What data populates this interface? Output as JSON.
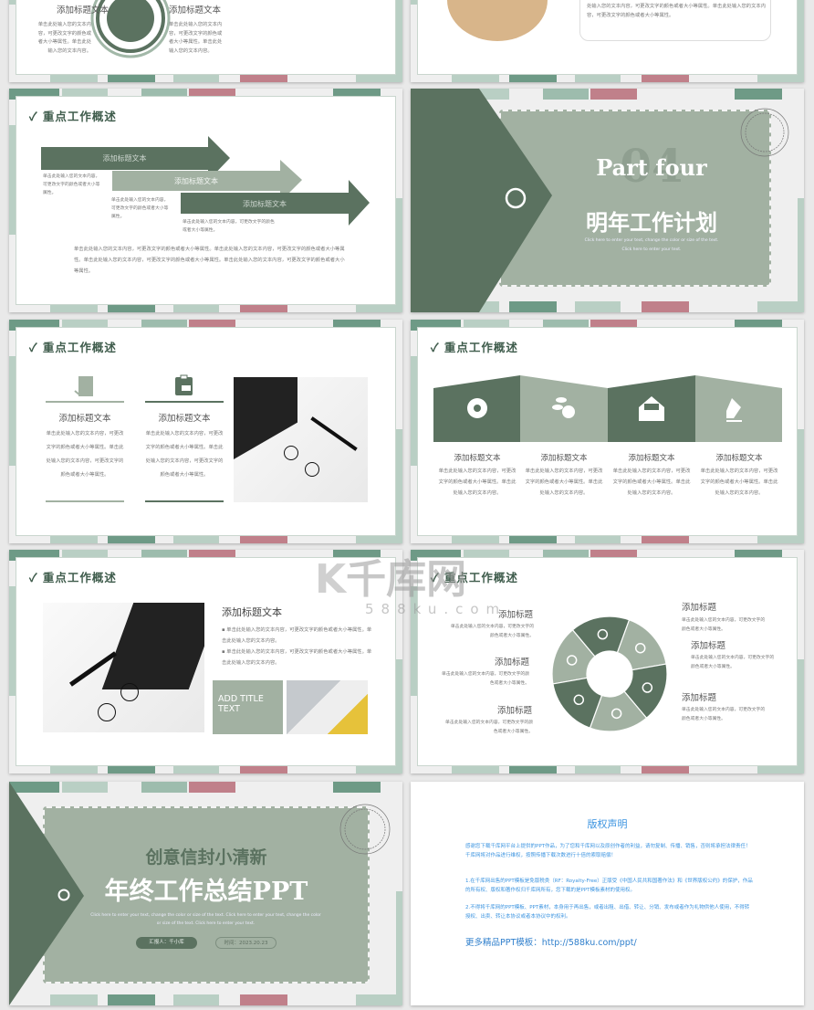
{
  "palette": {
    "dark_green": "#5b7260",
    "sage": "#a2b1a2",
    "teal": "#6e9a86",
    "mint": "#b9cfc4",
    "pink": "#c0808a",
    "copyright_blue": "#3c94e0"
  },
  "watermark": {
    "brand": "千库网",
    "domain": "588ku.com"
  },
  "section_title": "重点工作概述",
  "check_icon": "✓",
  "heading": "添加标题文本",
  "heading_short": "添加标题",
  "body_short": "单击此处输入您的文本内容，可更改文字的颜色或者大小等属性。",
  "body_long": "单击此处输入您的文本内容，可更改文字的颜色或者大小等属性。单击此处输入您的文本内容。",
  "body_col": "单击此处输入您的文本内容，可更改文字的颜色或者大小等属性。单击此处输入您的文本内容，可更改文字的颜色或者大小等属性。",
  "top_partial": {
    "left_text": "单击此处输入您的文本内容，可更改文字的颜色或者大小等属性。单击此处输入您的文本内容。",
    "right_text": "处输入您的文本内容，可更改文字的颜色或者大小等属性。单击此处输入您的文本内容，可更改文字的颜色或者大小等属性。"
  },
  "slide_arrows": {
    "paragraph": "单击此处输入您的文本内容，可更改文字的颜色或者大小等属性。单击此处输入您的文本内容，可更改文字的颜色或者大小等属性。单击此处输入您的文本内容，可更改文字的颜色或者大小等属性。单击此处输入您的文本内容，可更改文字的颜色或者大小等属性。"
  },
  "slide_part": {
    "number": "04",
    "part": "Part four",
    "title": "明年工作计划",
    "sub1": "Click here to enter your text, change the color or size of the text.",
    "sub2": "Click here to enter your text."
  },
  "slide_icons": {
    "icons": [
      "settings-icon",
      "coins-check-icon",
      "mail-open-icon",
      "pen-nib-icon"
    ]
  },
  "slide_photo": {
    "box_label": "ADD TITLE TEXT"
  },
  "slide_ring": {
    "icons": [
      "leaf-icon",
      "apple-icon",
      "image-icon",
      "document-icon",
      "microscope-icon",
      "target-icon"
    ]
  },
  "cover": {
    "subtitle": "创意信封小清新",
    "title": "年终工作总结PPT",
    "desc": "Click here to enter your text, change the color or size of the text. Click here to enter your text, change the color or size of the text. Click here to enter your text.",
    "reporter": "汇报人：千小库",
    "date": "时间：2023.20.23"
  },
  "copyright": {
    "title": "版权声明",
    "intro": "感谢您下载千库网平台上提供的PPT作品，为了您和千库网以及原创作者的利益，请勿复制、传播、销售，否则将承担法律责任！千库网将对作品进行维权，按照传播下载次数进行十倍的索取赔偿！",
    "item1": "1.在千库网出售的PPT模板是免版税类（RF：Royalty-Free）正版受《中国人民共和国著作法》和《世界版权公约》的保护，作品的所有权、版权和著作权归千库网所有，您下载的是PPT模板素材的使用权。",
    "item2": "2.不得将千库网的PPT模板、PPT素材，本身用于再出售，或者出租、出借、转让、分销、发布或者作为礼物供他人使用，不得转授权、出卖、转让本协议或者本协议中的权利。",
    "more": "更多精品PPT模板：http://588ku.com/ppt/"
  }
}
